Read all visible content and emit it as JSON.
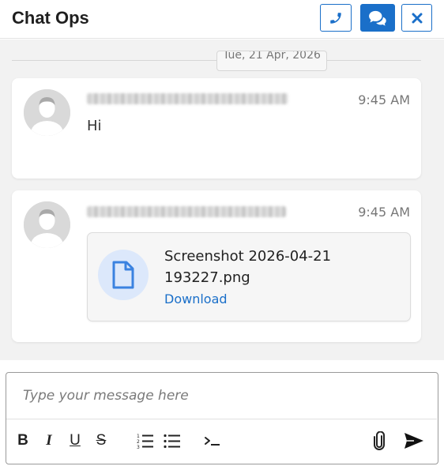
{
  "header": {
    "title": "Chat Ops",
    "buttons": [
      {
        "name": "call",
        "icon": "phone-icon"
      },
      {
        "name": "chat",
        "icon": "chat-bubbles-icon",
        "active": true
      },
      {
        "name": "close",
        "icon": "close-icon"
      }
    ]
  },
  "colors": {
    "accent": "#1a6fc9",
    "message_area_bg": "#f2f2f2",
    "file_icon_bg": "#dce8fb"
  },
  "thread": {
    "date_separator": "Tue, 21 Apr, 2026",
    "messages": [
      {
        "sender": "",
        "sender_redacted": true,
        "time": "9:45 AM",
        "text": "Hi"
      },
      {
        "sender": "",
        "sender_redacted": true,
        "time": "9:45 AM",
        "attachment": {
          "file_name": "Screenshot 2026-04-21 193227.png",
          "icon": "file-icon",
          "action_label": "Download"
        }
      }
    ]
  },
  "composer": {
    "placeholder": "Type your message here",
    "value": "",
    "tools": [
      {
        "name": "bold",
        "label": "B"
      },
      {
        "name": "italic",
        "label": "I"
      },
      {
        "name": "underline",
        "label": "U"
      },
      {
        "name": "strikethrough",
        "label": "S"
      },
      {
        "name": "ordered-list",
        "icon": "ordered-list-icon"
      },
      {
        "name": "bullet-list",
        "icon": "bullet-list-icon"
      },
      {
        "name": "code",
        "icon": "terminal-icon"
      },
      {
        "name": "attach",
        "icon": "paperclip-icon"
      },
      {
        "name": "send",
        "icon": "send-icon"
      }
    ]
  }
}
